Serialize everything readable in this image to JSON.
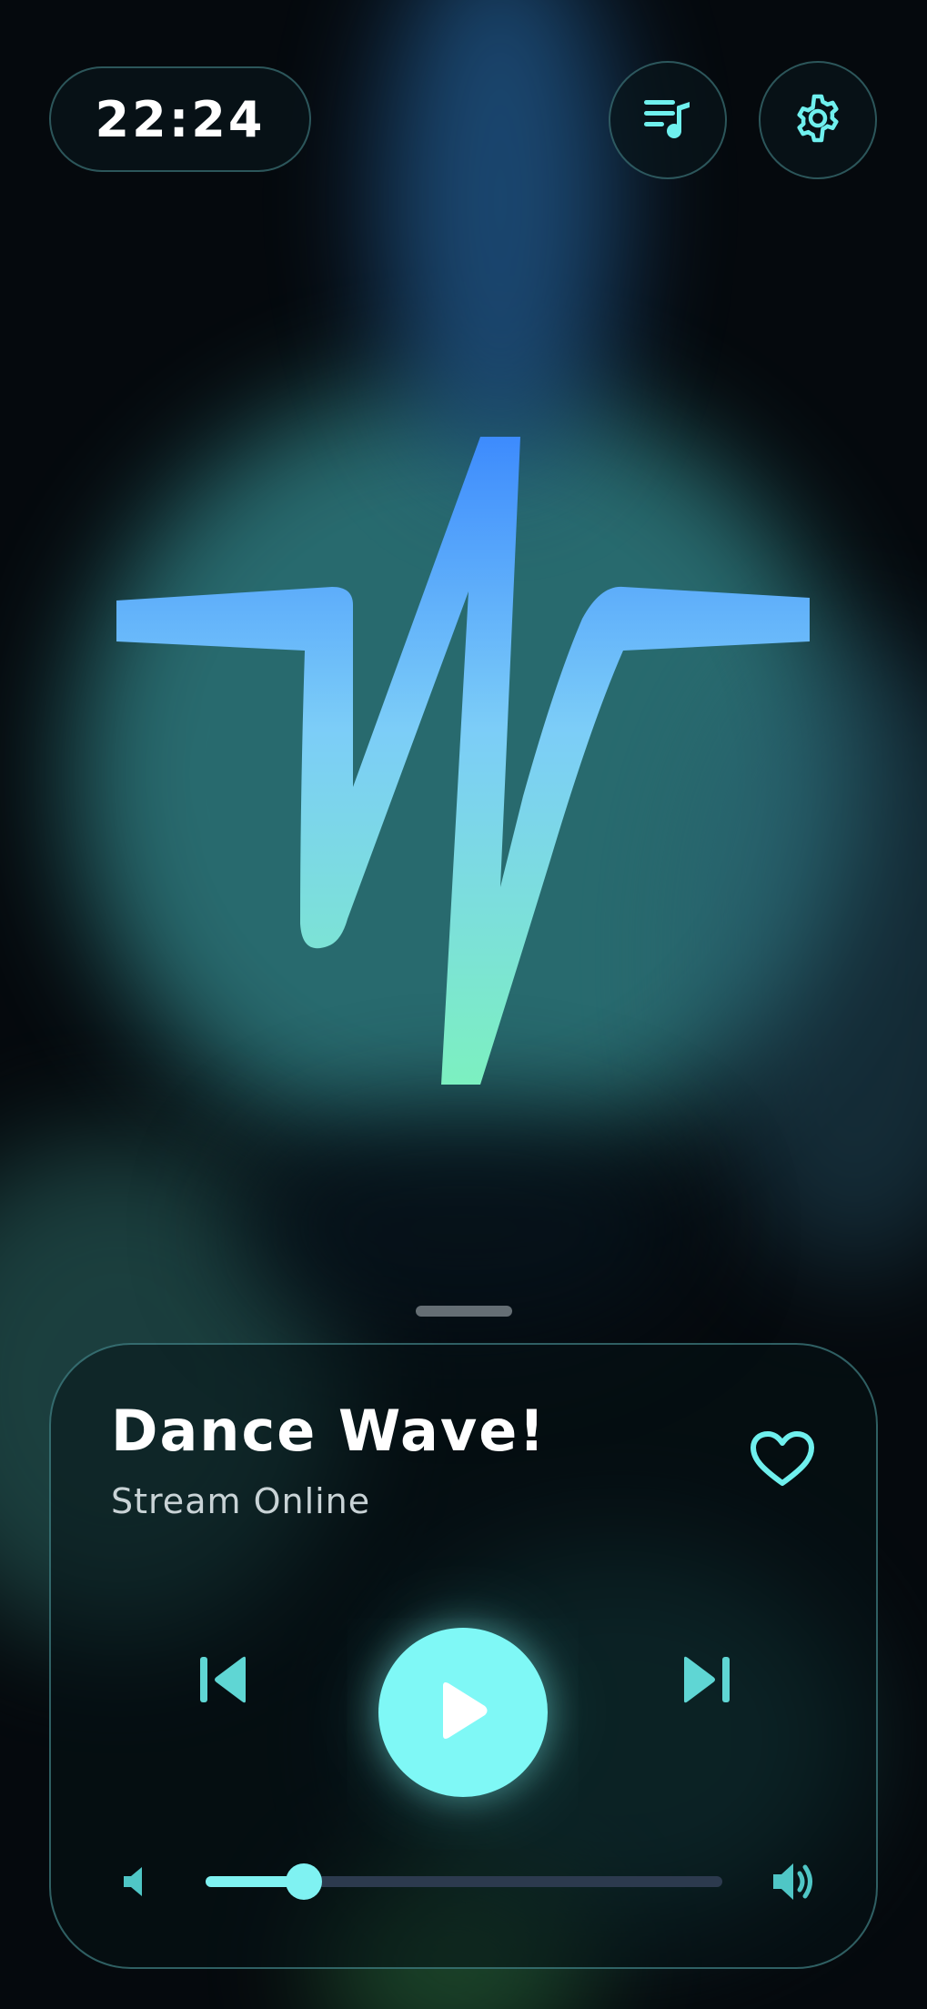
{
  "status": {
    "time": "22:24"
  },
  "header": {
    "playlist_icon": "playlist-music-icon",
    "settings_icon": "gear-icon"
  },
  "logo": {
    "icon": "waveform-logo-icon",
    "gradient_top": "#3d8bfd",
    "gradient_mid": "#82d5f8",
    "gradient_bottom": "#7cf0c0"
  },
  "player": {
    "title": "Dance Wave!",
    "subtitle": "Stream Online",
    "favorite_icon": "heart-outline-icon",
    "prev_icon": "skip-previous-icon",
    "play_icon": "play-icon",
    "next_icon": "skip-next-icon",
    "volume": {
      "low_icon": "volume-low-icon",
      "high_icon": "volume-high-icon",
      "level": 0.19
    }
  },
  "colors": {
    "accent": "#7ff8f6",
    "accent_icon": "#6ff0ee",
    "background": "#05090d",
    "slider_track": "#2c3a4e"
  }
}
